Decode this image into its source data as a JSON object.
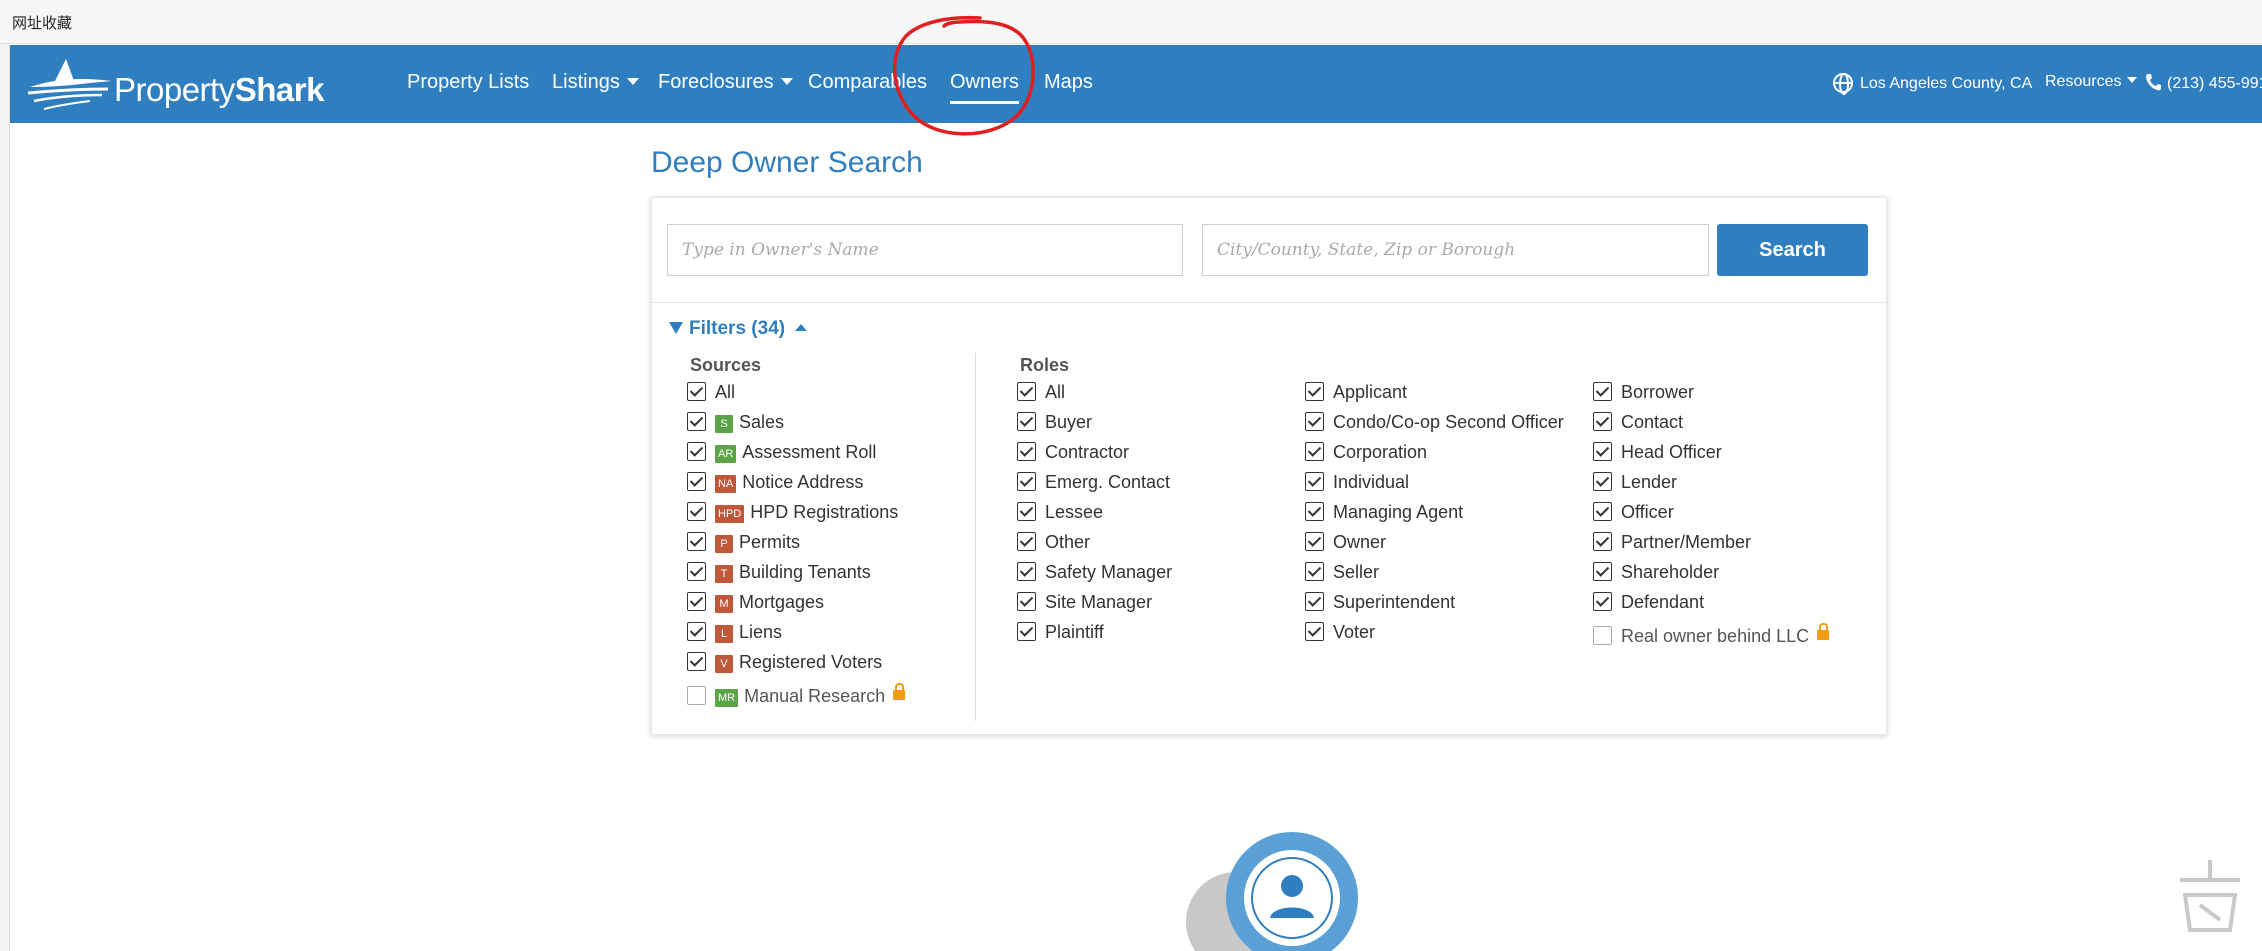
{
  "browser": {
    "bookmark_label": "网址收藏"
  },
  "brand": {
    "name_light": "Property",
    "name_bold": "Shark"
  },
  "nav": {
    "items": [
      {
        "label": "Property Lists",
        "caret": false
      },
      {
        "label": "Listings",
        "caret": true
      },
      {
        "label": "Foreclosures",
        "caret": true
      },
      {
        "label": "Comparables",
        "caret": false
      },
      {
        "label": "Owners",
        "caret": false,
        "active": true
      },
      {
        "label": "Maps",
        "caret": false
      }
    ],
    "location": "Los Angeles County, CA",
    "resources": "Resources",
    "phone": "(213) 455-991"
  },
  "page": {
    "title": "Deep Owner Search"
  },
  "search": {
    "owner_placeholder": "Type in Owner's Name",
    "location_placeholder": "City/County, State, Zip or Borough",
    "button_label": "Search"
  },
  "filters": {
    "toggle_label": "Filters (34)",
    "sources_heading": "Sources",
    "roles_heading": "Roles",
    "sources": [
      {
        "label": "All",
        "checked": true,
        "badge": ""
      },
      {
        "label": "Sales",
        "checked": true,
        "badge": "S",
        "badge_color": "#5aa447"
      },
      {
        "label": "Assessment Roll",
        "checked": true,
        "badge": "AR",
        "badge_color": "#5aa447"
      },
      {
        "label": "Notice Address",
        "checked": true,
        "badge": "NA",
        "badge_color": "#c0573a"
      },
      {
        "label": "HPD Registrations",
        "checked": true,
        "badge": "HPD",
        "badge_color": "#c0573a"
      },
      {
        "label": "Permits",
        "checked": true,
        "badge": "P",
        "badge_color": "#c0573a"
      },
      {
        "label": "Building Tenants",
        "checked": true,
        "badge": "T",
        "badge_color": "#c0573a"
      },
      {
        "label": "Mortgages",
        "checked": true,
        "badge": "M",
        "badge_color": "#c0573a"
      },
      {
        "label": "Liens",
        "checked": true,
        "badge": "L",
        "badge_color": "#c0573a"
      },
      {
        "label": "Registered Voters",
        "checked": true,
        "badge": "V",
        "badge_color": "#c0573a"
      },
      {
        "label": "Manual Research",
        "checked": false,
        "badge": "MR",
        "badge_color": "#5aa447",
        "locked": true
      }
    ],
    "roles_col1": [
      {
        "label": "All",
        "checked": true
      },
      {
        "label": "Buyer",
        "checked": true
      },
      {
        "label": "Contractor",
        "checked": true
      },
      {
        "label": "Emerg. Contact",
        "checked": true
      },
      {
        "label": "Lessee",
        "checked": true
      },
      {
        "label": "Other",
        "checked": true
      },
      {
        "label": "Safety Manager",
        "checked": true
      },
      {
        "label": "Site Manager",
        "checked": true
      },
      {
        "label": "Plaintiff",
        "checked": true
      }
    ],
    "roles_col2": [
      {
        "label": "Applicant",
        "checked": true
      },
      {
        "label": "Condo/Co-op Second Officer",
        "checked": true
      },
      {
        "label": "Corporation",
        "checked": true
      },
      {
        "label": "Individual",
        "checked": true
      },
      {
        "label": "Managing Agent",
        "checked": true
      },
      {
        "label": "Owner",
        "checked": true
      },
      {
        "label": "Seller",
        "checked": true
      },
      {
        "label": "Superintendent",
        "checked": true
      },
      {
        "label": "Voter",
        "checked": true
      }
    ],
    "roles_col3": [
      {
        "label": "Borrower",
        "checked": true
      },
      {
        "label": "Contact",
        "checked": true
      },
      {
        "label": "Head Officer",
        "checked": true
      },
      {
        "label": "Lender",
        "checked": true
      },
      {
        "label": "Officer",
        "checked": true
      },
      {
        "label": "Partner/Member",
        "checked": true
      },
      {
        "label": "Shareholder",
        "checked": true
      },
      {
        "label": "Defendant",
        "checked": true
      },
      {
        "label": "Real owner behind LLC",
        "checked": false,
        "locked": true
      }
    ]
  },
  "colors": {
    "brand_blue": "#2f7fc0",
    "annotation_red": "#e02020"
  }
}
